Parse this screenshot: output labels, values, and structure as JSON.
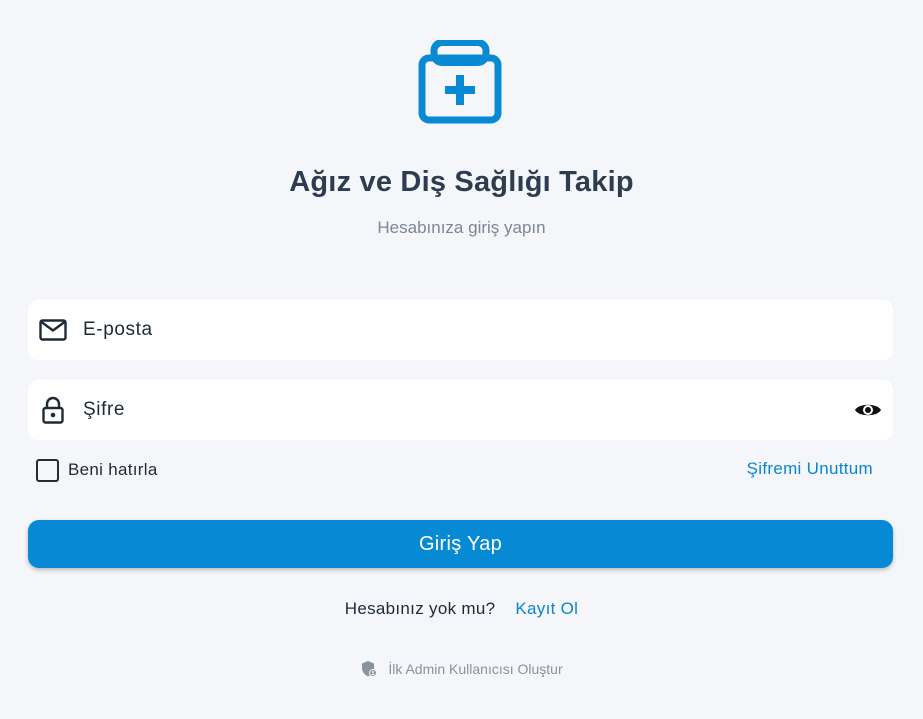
{
  "header": {
    "logo_icon": "medical-kit-icon",
    "title": "Ağız ve Diş Sağlığı Takip",
    "subtitle": "Hesabınıza giriş yapın"
  },
  "form": {
    "email": {
      "placeholder": "E-posta",
      "icon": "mail-icon"
    },
    "password": {
      "placeholder": "Şifre",
      "icon": "lock-icon",
      "toggle_icon": "eye-icon"
    },
    "remember_me": {
      "label": "Beni hatırla",
      "checked": false
    },
    "forgot_password": "Şifremi Unuttum",
    "submit_label": "Giriş Yap"
  },
  "signup": {
    "question": "Hesabınız yok mu?",
    "link": "Kayıt Ol"
  },
  "admin": {
    "icon": "admin-shield-icon",
    "label": "İlk Admin Kullanıcısı Oluştur"
  },
  "colors": {
    "accent": "#0889d4",
    "background": "#f4f6fa",
    "title": "#2d3d4f",
    "muted": "#8a929c"
  }
}
